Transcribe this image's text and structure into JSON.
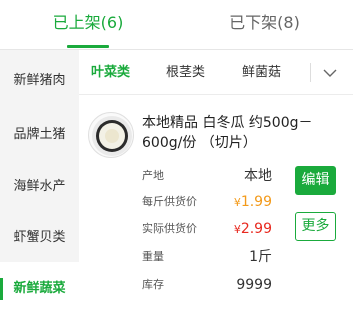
{
  "top_tabs": [
    {
      "label": "已上架(6)",
      "active": true
    },
    {
      "label": "已下架(8)",
      "active": false
    }
  ],
  "sidebar": {
    "items": [
      {
        "label": "新鲜猪肉"
      },
      {
        "label": "品牌土猪"
      },
      {
        "label": "海鲜水产"
      },
      {
        "label": "虾蟹贝类"
      },
      {
        "label": "新鲜蔬菜",
        "active": true
      }
    ]
  },
  "subtabs": {
    "items": [
      {
        "label": "叶菜类",
        "active": true
      },
      {
        "label": "根茎类"
      },
      {
        "label": "鲜菌菇"
      }
    ],
    "dropdown_icon": "chevron-down-icon"
  },
  "product": {
    "title": "本地精品 白冬瓜 约500g－600g/份 （切片）",
    "fields": {
      "origin_label": "产地",
      "origin_value": "本地",
      "per_jin_label": "每斤供货价",
      "per_jin_currency": "¥",
      "per_jin_value": "1.99",
      "actual_label": "实际供货价",
      "actual_currency": "¥",
      "actual_value": "2.99",
      "weight_label": "重量",
      "weight_value": "1斤",
      "stock_label": "库存",
      "stock_value": "9999"
    },
    "edit_button": "编辑",
    "more_button": "更多"
  },
  "colors": {
    "accent": "#1aaa3c",
    "price_orange": "#f39a1a",
    "price_red": "#e8291f",
    "sidebar_bg": "#f4f4f4"
  }
}
